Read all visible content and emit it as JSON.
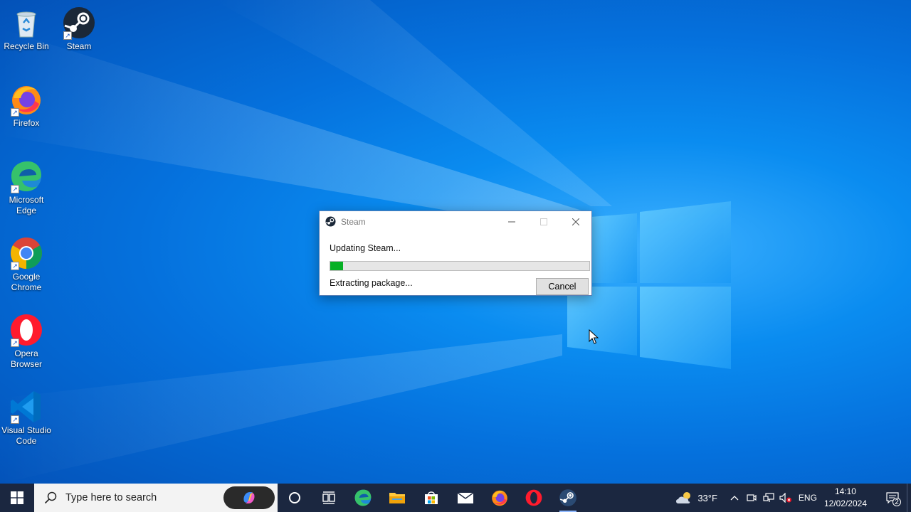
{
  "desktop": {
    "icons": [
      {
        "label": "Recycle Bin",
        "icon": "recycle-bin-icon"
      },
      {
        "label": "Steam",
        "icon": "steam-icon"
      },
      {
        "label": "Firefox",
        "icon": "firefox-icon"
      },
      {
        "label": "Microsoft Edge",
        "icon": "edge-icon"
      },
      {
        "label": "Google Chrome",
        "icon": "chrome-icon"
      },
      {
        "label": "Opera Browser",
        "icon": "opera-icon"
      },
      {
        "label": "Visual Studio Code",
        "icon": "vscode-icon"
      }
    ]
  },
  "dialog": {
    "title": "Steam",
    "status": "Updating Steam...",
    "substatus": "Extracting package...",
    "progress_fraction": 0.05,
    "cancel_label": "Cancel",
    "progress_color": "#06b025"
  },
  "taskbar": {
    "search_placeholder": "Type here to search",
    "apps": [
      "task-view",
      "edge",
      "file-explorer",
      "microsoft-store",
      "mail",
      "firefox",
      "opera",
      "steam"
    ],
    "active_app": "steam",
    "weather_temp": "33°F",
    "language": "ENG",
    "time": "14:10",
    "date": "12/02/2024",
    "notification_count": "2"
  }
}
